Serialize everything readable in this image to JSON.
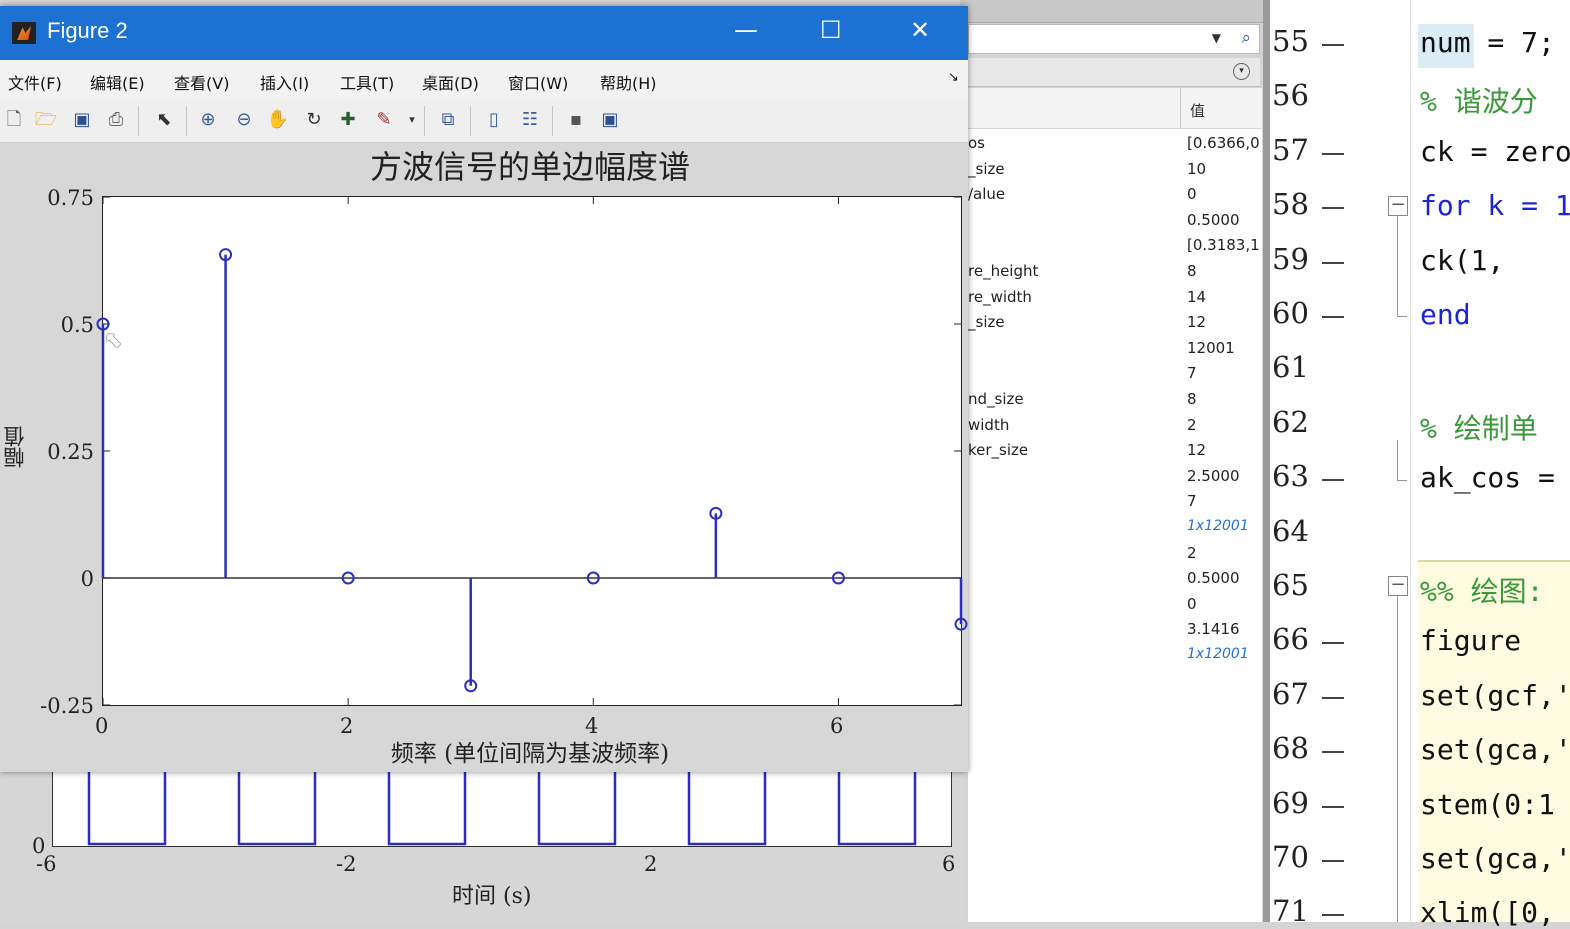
{
  "figure_window": {
    "title": "Figure 2",
    "controls": {
      "minimize": "—",
      "maximize": "☐",
      "close": "✕"
    },
    "menu": [
      "文件(F)",
      "编辑(E)",
      "查看(V)",
      "插入(I)",
      "工具(T)",
      "桌面(D)",
      "窗口(W)",
      "帮助(H)"
    ],
    "menu_arrow": "↘"
  },
  "chart_data": {
    "type": "stem",
    "title": "方波信号的单边幅度谱",
    "xlabel": "频率 (单位间隔为基波频率)",
    "ylabel": "幅值",
    "xlim": [
      0,
      7
    ],
    "ylim": [
      -0.25,
      0.75
    ],
    "xticks": [
      "0",
      "2",
      "4",
      "6"
    ],
    "yticks": [
      "-0.25",
      "0",
      "0.25",
      "0.5",
      "0.75"
    ],
    "x": [
      0,
      1,
      2,
      3,
      4,
      5,
      6,
      7
    ],
    "values": [
      0.5,
      0.6366,
      0,
      -0.2122,
      0,
      0.1273,
      0,
      -0.0909
    ],
    "color": "#2b2fc0"
  },
  "lower_plot": {
    "xlabel": "时间 (s)",
    "xticks": [
      "-6",
      "-2",
      "2",
      "6"
    ],
    "ytick": "0"
  },
  "workspace": {
    "value_header": "值",
    "rows": [
      {
        "name": "os",
        "value": "[0.6366,0"
      },
      {
        "name": "_size",
        "value": "10"
      },
      {
        "name": "/alue",
        "value": "0"
      },
      {
        "name": "",
        "value": "0.5000"
      },
      {
        "name": "",
        "value": "[0.3183,1"
      },
      {
        "name": "re_height",
        "value": "8"
      },
      {
        "name": "re_width",
        "value": "14"
      },
      {
        "name": "_size",
        "value": "12"
      },
      {
        "name": "",
        "value": "12001"
      },
      {
        "name": "",
        "value": "7"
      },
      {
        "name": "nd_size",
        "value": "8"
      },
      {
        "name": "width",
        "value": "2"
      },
      {
        "name": "ker_size",
        "value": "12"
      },
      {
        "name": "",
        "value": "2.5000"
      },
      {
        "name": "",
        "value": "7"
      },
      {
        "name": "",
        "value": "1x12001",
        "link": true
      },
      {
        "name": "",
        "value": "2"
      },
      {
        "name": "",
        "value": "0.5000"
      },
      {
        "name": "",
        "value": "0"
      },
      {
        "name": "",
        "value": "3.1416"
      },
      {
        "name": "",
        "value": "1x12001",
        "link": true
      }
    ]
  },
  "editor": {
    "lines": [
      {
        "n": "55",
        "dash": true,
        "code": "num = 7;",
        "kind": "normal"
      },
      {
        "n": "56",
        "dash": false,
        "code": "% 谐波分",
        "kind": "comment"
      },
      {
        "n": "57",
        "dash": true,
        "code": "ck = zero",
        "kind": "normal"
      },
      {
        "n": "58",
        "dash": true,
        "code": "for k = 1",
        "kind": "keyword"
      },
      {
        "n": "59",
        "dash": true,
        "code": "    ck(1,",
        "kind": "normal"
      },
      {
        "n": "60",
        "dash": true,
        "code": "end",
        "kind": "keyword"
      },
      {
        "n": "61",
        "dash": false,
        "code": "",
        "kind": "normal"
      },
      {
        "n": "62",
        "dash": false,
        "code": "% 绘制单",
        "kind": "comment"
      },
      {
        "n": "63",
        "dash": true,
        "code": "ak_cos =",
        "kind": "normal"
      },
      {
        "n": "64",
        "dash": false,
        "code": "",
        "kind": "normal"
      },
      {
        "n": "65",
        "dash": false,
        "code": "%% 绘图:",
        "kind": "comment"
      },
      {
        "n": "66",
        "dash": true,
        "code": "figure",
        "kind": "normal"
      },
      {
        "n": "67",
        "dash": true,
        "code": "set(gcf,'",
        "kind": "normal"
      },
      {
        "n": "68",
        "dash": true,
        "code": "set(gca,'",
        "kind": "normal"
      },
      {
        "n": "69",
        "dash": true,
        "code": "stem(0:1",
        "kind": "normal"
      },
      {
        "n": "70",
        "dash": true,
        "code": "set(gca,'",
        "kind": "normal"
      },
      {
        "n": "71",
        "dash": true,
        "code": "xlim([0,",
        "kind": "normal"
      }
    ]
  }
}
